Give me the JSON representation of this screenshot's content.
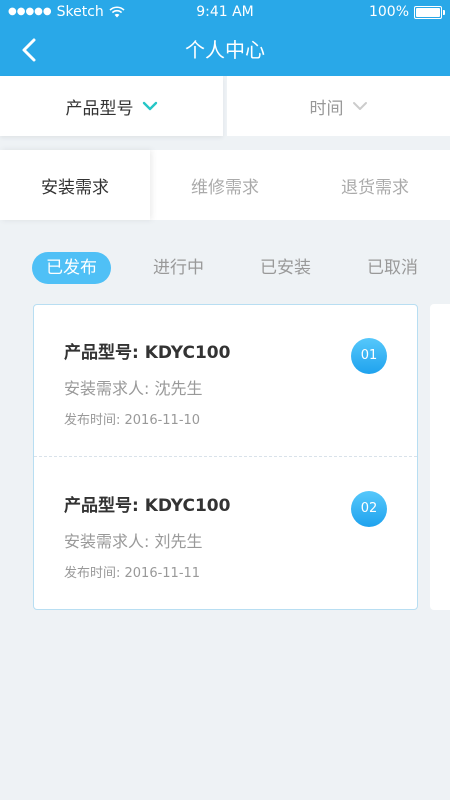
{
  "status_bar": {
    "signal": "●●●●●",
    "carrier": "Sketch",
    "time": "9:41 AM",
    "battery": "100%"
  },
  "nav": {
    "title": "个人中心",
    "back_icon": "chevron-left-icon"
  },
  "filters": [
    {
      "label": "产品型号",
      "state": "active"
    },
    {
      "label": "时间",
      "state": "inactive"
    }
  ],
  "request_types": [
    "安装需求",
    "维修需求",
    "退货需求"
  ],
  "status_tabs": [
    "已发布",
    "进行中",
    "已安装",
    "已取消"
  ],
  "requests": [
    {
      "model_label": "产品型号: KDYC100",
      "requester_label": "安装需求人: 沈先生",
      "date_label": "发布时间: 2016-11-10",
      "badge": "01"
    },
    {
      "model_label": "产品型号: KDYC100",
      "requester_label": "安装需求人: 刘先生",
      "date_label": "发布时间: 2016-11-11",
      "badge": "02"
    }
  ],
  "colors": {
    "primary": "#29a8e8",
    "active_tab": "#4fc0f6",
    "filter_chevron_active": "#26c6c6",
    "background": "#eef2f5"
  }
}
